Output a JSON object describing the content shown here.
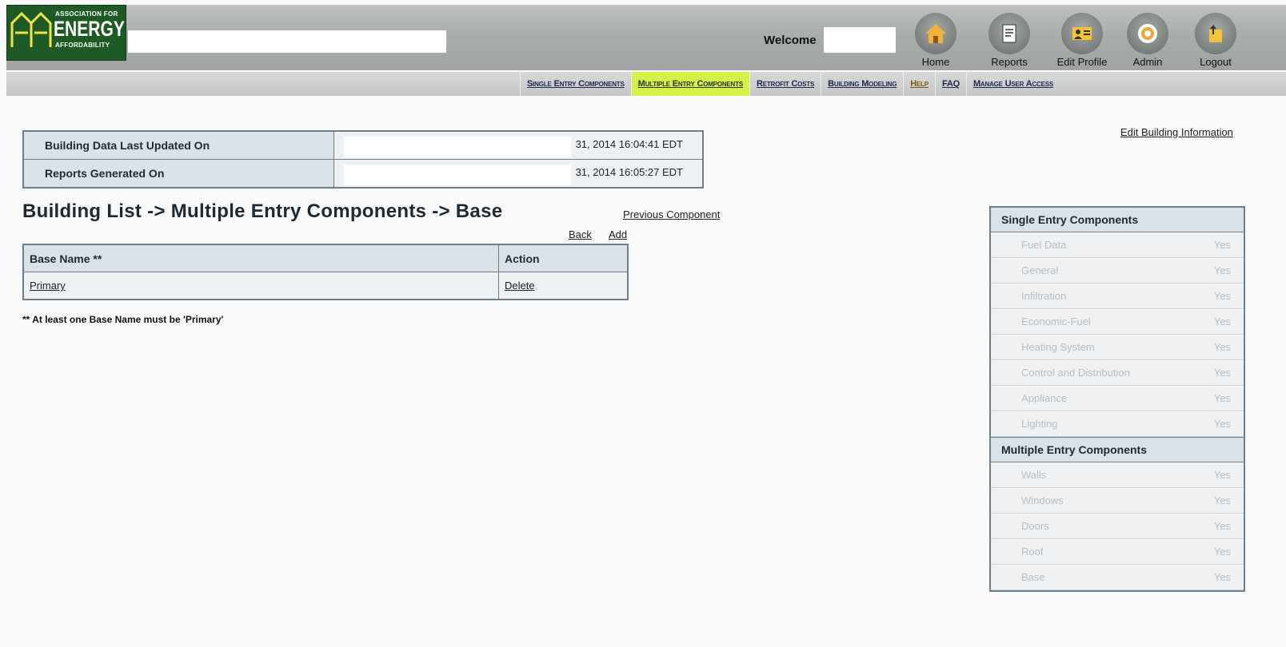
{
  "logo": {
    "line1": "ASSOCIATION FOR",
    "line2": "ENERGY",
    "line3": "AFFORDABILITY"
  },
  "header": {
    "welcome": "Welcome",
    "nav": [
      {
        "label": "Home",
        "icon": "home-icon"
      },
      {
        "label": "Reports",
        "icon": "reports-icon"
      },
      {
        "label": "Edit Profile",
        "icon": "edit-profile-icon"
      },
      {
        "label": "Admin",
        "icon": "admin-icon"
      },
      {
        "label": "Logout",
        "icon": "logout-icon"
      }
    ]
  },
  "menu": {
    "items": [
      "Single Entry Components",
      "Multiple Entry Components",
      "Retrofit Costs",
      "Building Modeling",
      "Help",
      "FAQ",
      "Manage User Access"
    ],
    "active": "Multiple Entry Components",
    "active_color": "#d6f04a"
  },
  "info": {
    "last_updated_label": "Building Data Last Updated On",
    "last_updated_value": "31, 2014 16:04:41 EDT",
    "reports_label": "Reports Generated On",
    "reports_value": "31, 2014 16:05:27 EDT"
  },
  "edit_building_link": "Edit Building Information",
  "page_title": "Building List -> Multiple Entry Components -> Base",
  "previous_component_link": "Previous Component",
  "back_link": "Back",
  "add_link": "Add",
  "base_table": {
    "headers": [
      "Base Name **",
      "Action"
    ],
    "rows": [
      {
        "name": "Primary",
        "action": "Delete"
      }
    ]
  },
  "footnote": "**  At least one Base Name must be 'Primary'",
  "sidebar": {
    "single_title": "Single Entry Components",
    "single_items": [
      {
        "name": "Fuel Data",
        "status": "Yes"
      },
      {
        "name": "General",
        "status": "Yes"
      },
      {
        "name": "Infiltration",
        "status": "Yes"
      },
      {
        "name": "Economic-Fuel",
        "status": "Yes"
      },
      {
        "name": "Heating System",
        "status": "Yes"
      },
      {
        "name": "Control and Distribution",
        "status": "Yes"
      },
      {
        "name": "Appliance",
        "status": "Yes"
      },
      {
        "name": "Lighting",
        "status": "Yes"
      }
    ],
    "multiple_title": "Multiple Entry Components",
    "multiple_items": [
      {
        "name": "Walls",
        "status": "Yes"
      },
      {
        "name": "Windows",
        "status": "Yes"
      },
      {
        "name": "Doors",
        "status": "Yes"
      },
      {
        "name": "Roof",
        "status": "Yes"
      },
      {
        "name": "Base",
        "status": "Yes"
      }
    ]
  }
}
